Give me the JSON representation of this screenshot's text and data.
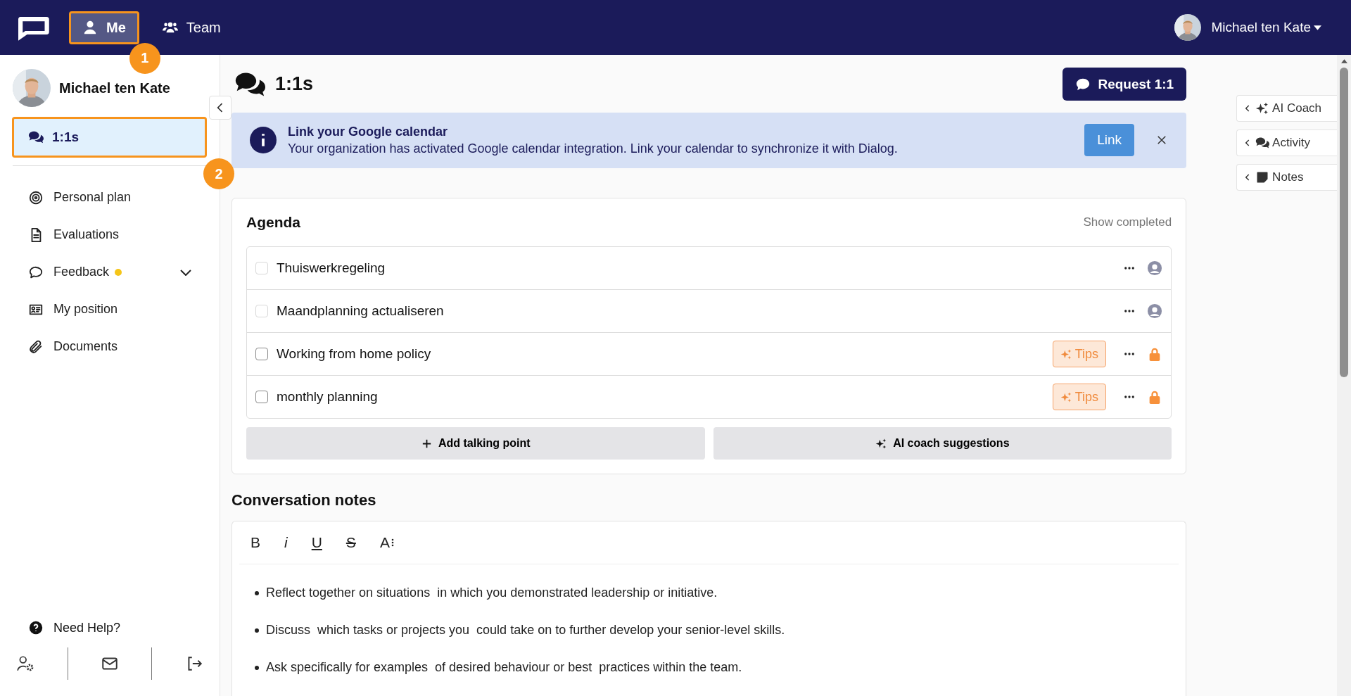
{
  "topbar": {
    "nav": [
      {
        "label": "Me",
        "selected": true,
        "highlighted": true,
        "marker": "1"
      },
      {
        "label": "Team",
        "selected": false,
        "highlighted": false
      }
    ],
    "user": {
      "name": "Michael ten Kate"
    }
  },
  "sidebar": {
    "profile_name": "Michael ten Kate",
    "primary": {
      "label": "1:1s",
      "selected": true,
      "highlighted": true,
      "marker": "2"
    },
    "items": [
      {
        "label": "Personal plan",
        "notification": false
      },
      {
        "label": "Evaluations",
        "notification": false
      },
      {
        "label": "Feedback",
        "notification": true,
        "submenu": {
          "expanded": false
        }
      },
      {
        "label": "My position",
        "notification": false
      },
      {
        "label": "Documents",
        "notification": false
      }
    ],
    "help": "Need Help?"
  },
  "page": {
    "title": "1:1s",
    "request_button": "Request 1:1"
  },
  "banner": {
    "title": "Link your Google calendar",
    "text": "Your organization has activated Google calendar integration. Link your calendar to synchronize it with Dialog.",
    "button": "Link"
  },
  "agenda": {
    "title": "Agenda",
    "show_completed": "Show completed",
    "items": [
      {
        "label": "Thuiswerkregeling",
        "checked": false,
        "disabled": true,
        "kind": "shared"
      },
      {
        "label": "Maandplanning actualiseren",
        "checked": false,
        "disabled": true,
        "kind": "shared"
      },
      {
        "label": "Working from home policy",
        "checked": false,
        "disabled": false,
        "tips": "Tips",
        "kind": "private"
      },
      {
        "label": "monthly planning",
        "checked": false,
        "disabled": false,
        "tips": "Tips",
        "kind": "private"
      }
    ],
    "buttons": [
      {
        "label": "Add talking point"
      },
      {
        "label": "AI coach suggestions"
      }
    ]
  },
  "notes": {
    "title": "Conversation notes",
    "toolbar": [
      {
        "label": "B",
        "kind": "bold"
      },
      {
        "label": "i",
        "kind": "italic"
      },
      {
        "label": "U",
        "kind": "underline"
      },
      {
        "label": "S",
        "kind": "strike"
      },
      {
        "label": "A",
        "kind": "size"
      }
    ],
    "bullets": [
      "Reflect together on situations  in which you demonstrated leadership or initiative.",
      "Discuss  which tasks or projects you  could take on to further develop your senior-level skills.",
      "Ask specifically for examples  of desired behaviour or best  practices within the team."
    ]
  },
  "side_panels": [
    {
      "label": "AI Coach"
    },
    {
      "label": "Activity"
    },
    {
      "label": "Notes"
    }
  ]
}
